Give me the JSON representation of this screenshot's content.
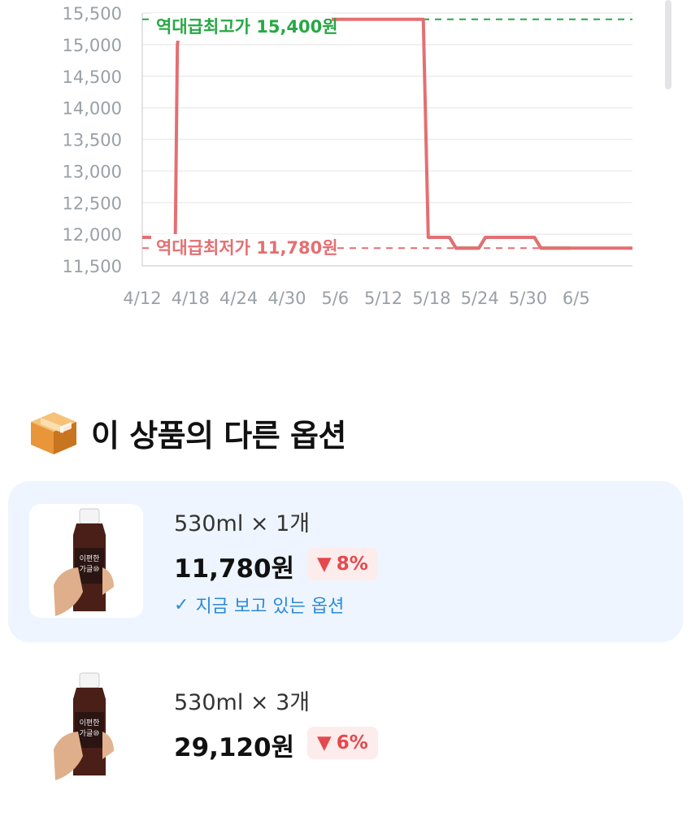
{
  "chart_data": {
    "type": "line",
    "y_ticks": [
      "15,500",
      "15,000",
      "14,500",
      "14,000",
      "13,500",
      "13,000",
      "12,500",
      "12,000",
      "11,500"
    ],
    "x_ticks": [
      "4/12",
      "4/18",
      "4/24",
      "4/30",
      "5/6",
      "5/12",
      "5/18",
      "5/24",
      "5/30",
      "6/5"
    ],
    "ylim": [
      11500,
      15500
    ],
    "grid": true,
    "annotations": {
      "high_label": "역대급최고가 15,400원",
      "high_value": 15400,
      "low_label": "역대급최저가 11,780원",
      "low_value": 11780
    },
    "series": [
      {
        "color": "#e46f72",
        "x": [
          0,
          11.7,
          12.2,
          19.8,
          20.2,
          21.5,
          22.0,
          23.5,
          50.0,
          100.0,
          116.0,
          142.0,
          144.0,
          172.0,
          175.0,
          188.0,
          192.0,
          206.0,
          210.0,
          240.0,
          244.0,
          258.0,
          262.0,
          300.0
        ],
        "y": [
          11950,
          11950,
          11850,
          11850,
          11900,
          15000,
          15100,
          15400,
          15400,
          15400,
          15400,
          15400,
          15400,
          15400,
          11950,
          11950,
          11780,
          11780,
          11950,
          11950,
          11780,
          11780,
          11780,
          11780
        ]
      },
      {
        "color": "#27a844",
        "x": [
          175.0,
          182.0,
          188.0,
          192.0,
          206.0,
          210.0,
          220.0,
          240.0,
          244.0,
          258.0,
          262.0
        ],
        "y": [
          11950,
          11950,
          11950,
          11780,
          11780,
          11950,
          11950,
          11950,
          11780,
          11780,
          11780
        ]
      }
    ]
  },
  "section": {
    "title": "이 상품의 다른 옵션",
    "icon": "package-box-icon"
  },
  "options": [
    {
      "name": "530ml × 1개",
      "price": "11,780원",
      "discount": "8%",
      "discount_icon": "down-triangle-icon",
      "current_label": "지금 보고 있는 옵션",
      "current_icon": "checkmark-icon"
    },
    {
      "name": "530ml × 3개",
      "price": "29,120원",
      "discount": "6%",
      "discount_icon": "down-triangle-icon"
    }
  ],
  "product_image_text": [
    "이편한",
    "가글",
    "⑩"
  ],
  "colors": {
    "red_line": "#e46f72",
    "green_line": "#27a844",
    "card_bg": "#eef5fe",
    "badge_bg": "#fdecec",
    "badge_text": "#e5484d",
    "current_text": "#2b8ad8"
  }
}
